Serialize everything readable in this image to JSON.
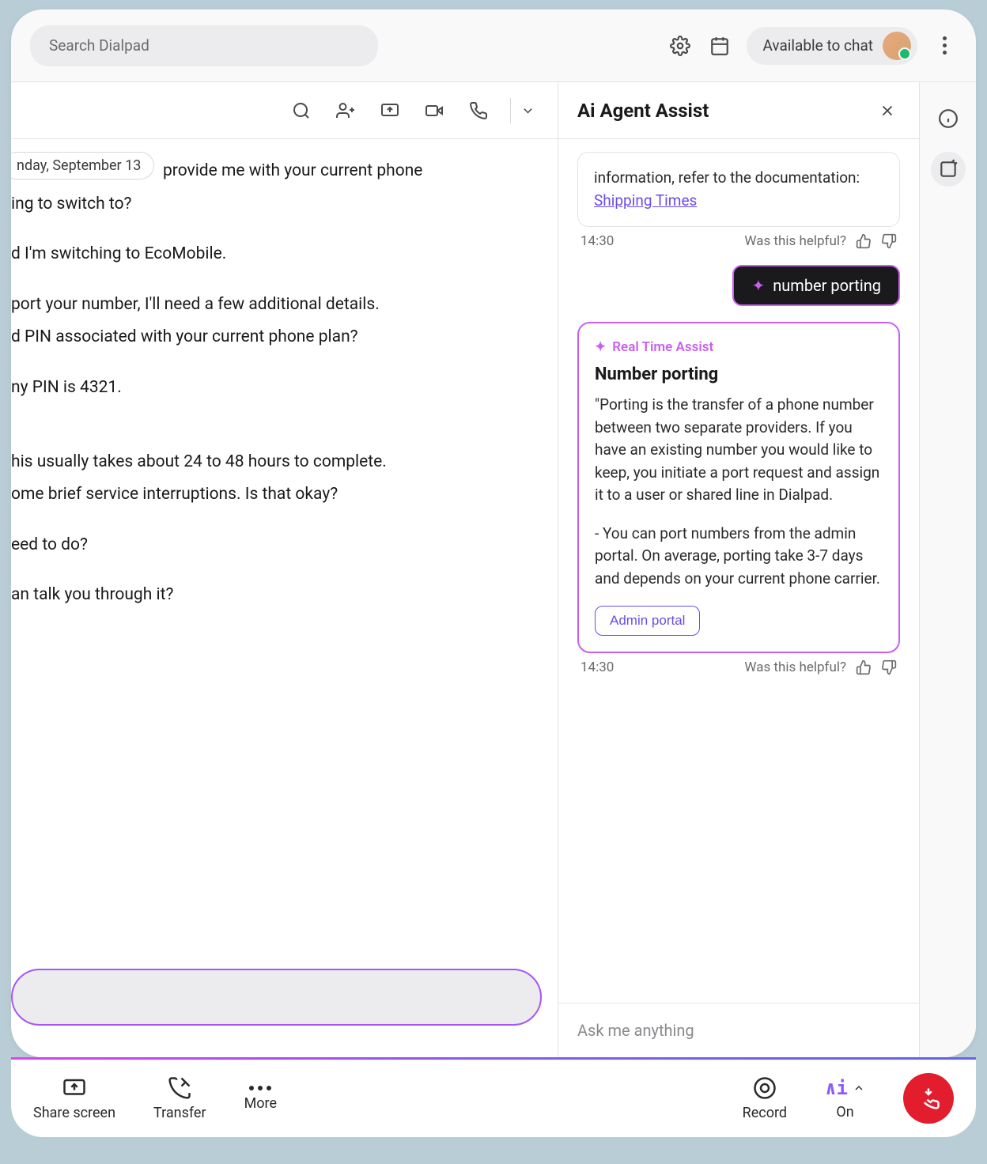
{
  "topbar": {
    "search_placeholder": "Search Dialpad",
    "status_label": "Available to chat"
  },
  "chat": {
    "date_label": "nday, September 13",
    "lines": {
      "l1a": "provide me with your current phone",
      "l1b": "ing to switch to?",
      "l2": "d I'm switching to EcoMobile.",
      "l3a": "port your number, I'll need a few additional details.",
      "l3b": "d PIN associated with your current phone plan?",
      "l4": "ny PIN is 4321.",
      "l5a": "his usually takes about 24 to 48 hours to complete.",
      "l5b": "ome brief service interruptions. Is that okay?",
      "l6": "eed to do?",
      "l7": "an talk you through it?"
    }
  },
  "assist": {
    "title": "Ai Agent Assist",
    "card1_text": "information, refer to the documentation: ",
    "card1_link": "Shipping Times",
    "time1": "14:30",
    "helpful_label": "Was this helpful?",
    "query_label": "number porting",
    "rta_badge": "Real Time Assist",
    "rta_title": "Number porting",
    "rta_p1": "\"Porting is the transfer of a phone number between two separate providers. If you have an existing number you would like to keep, you initiate a port request and assign it to a user or shared line in Dialpad.",
    "rta_p2": "- You can port numbers from the admin portal. On average, porting take 3-7 days and depends on your current phone carrier.",
    "portal_btn": "Admin portal",
    "time2": "14:30",
    "input_placeholder": "Ask me anything"
  },
  "bottom": {
    "share": "Share screen",
    "transfer": "Transfer",
    "more": "More",
    "record": "Record",
    "on": "On"
  }
}
